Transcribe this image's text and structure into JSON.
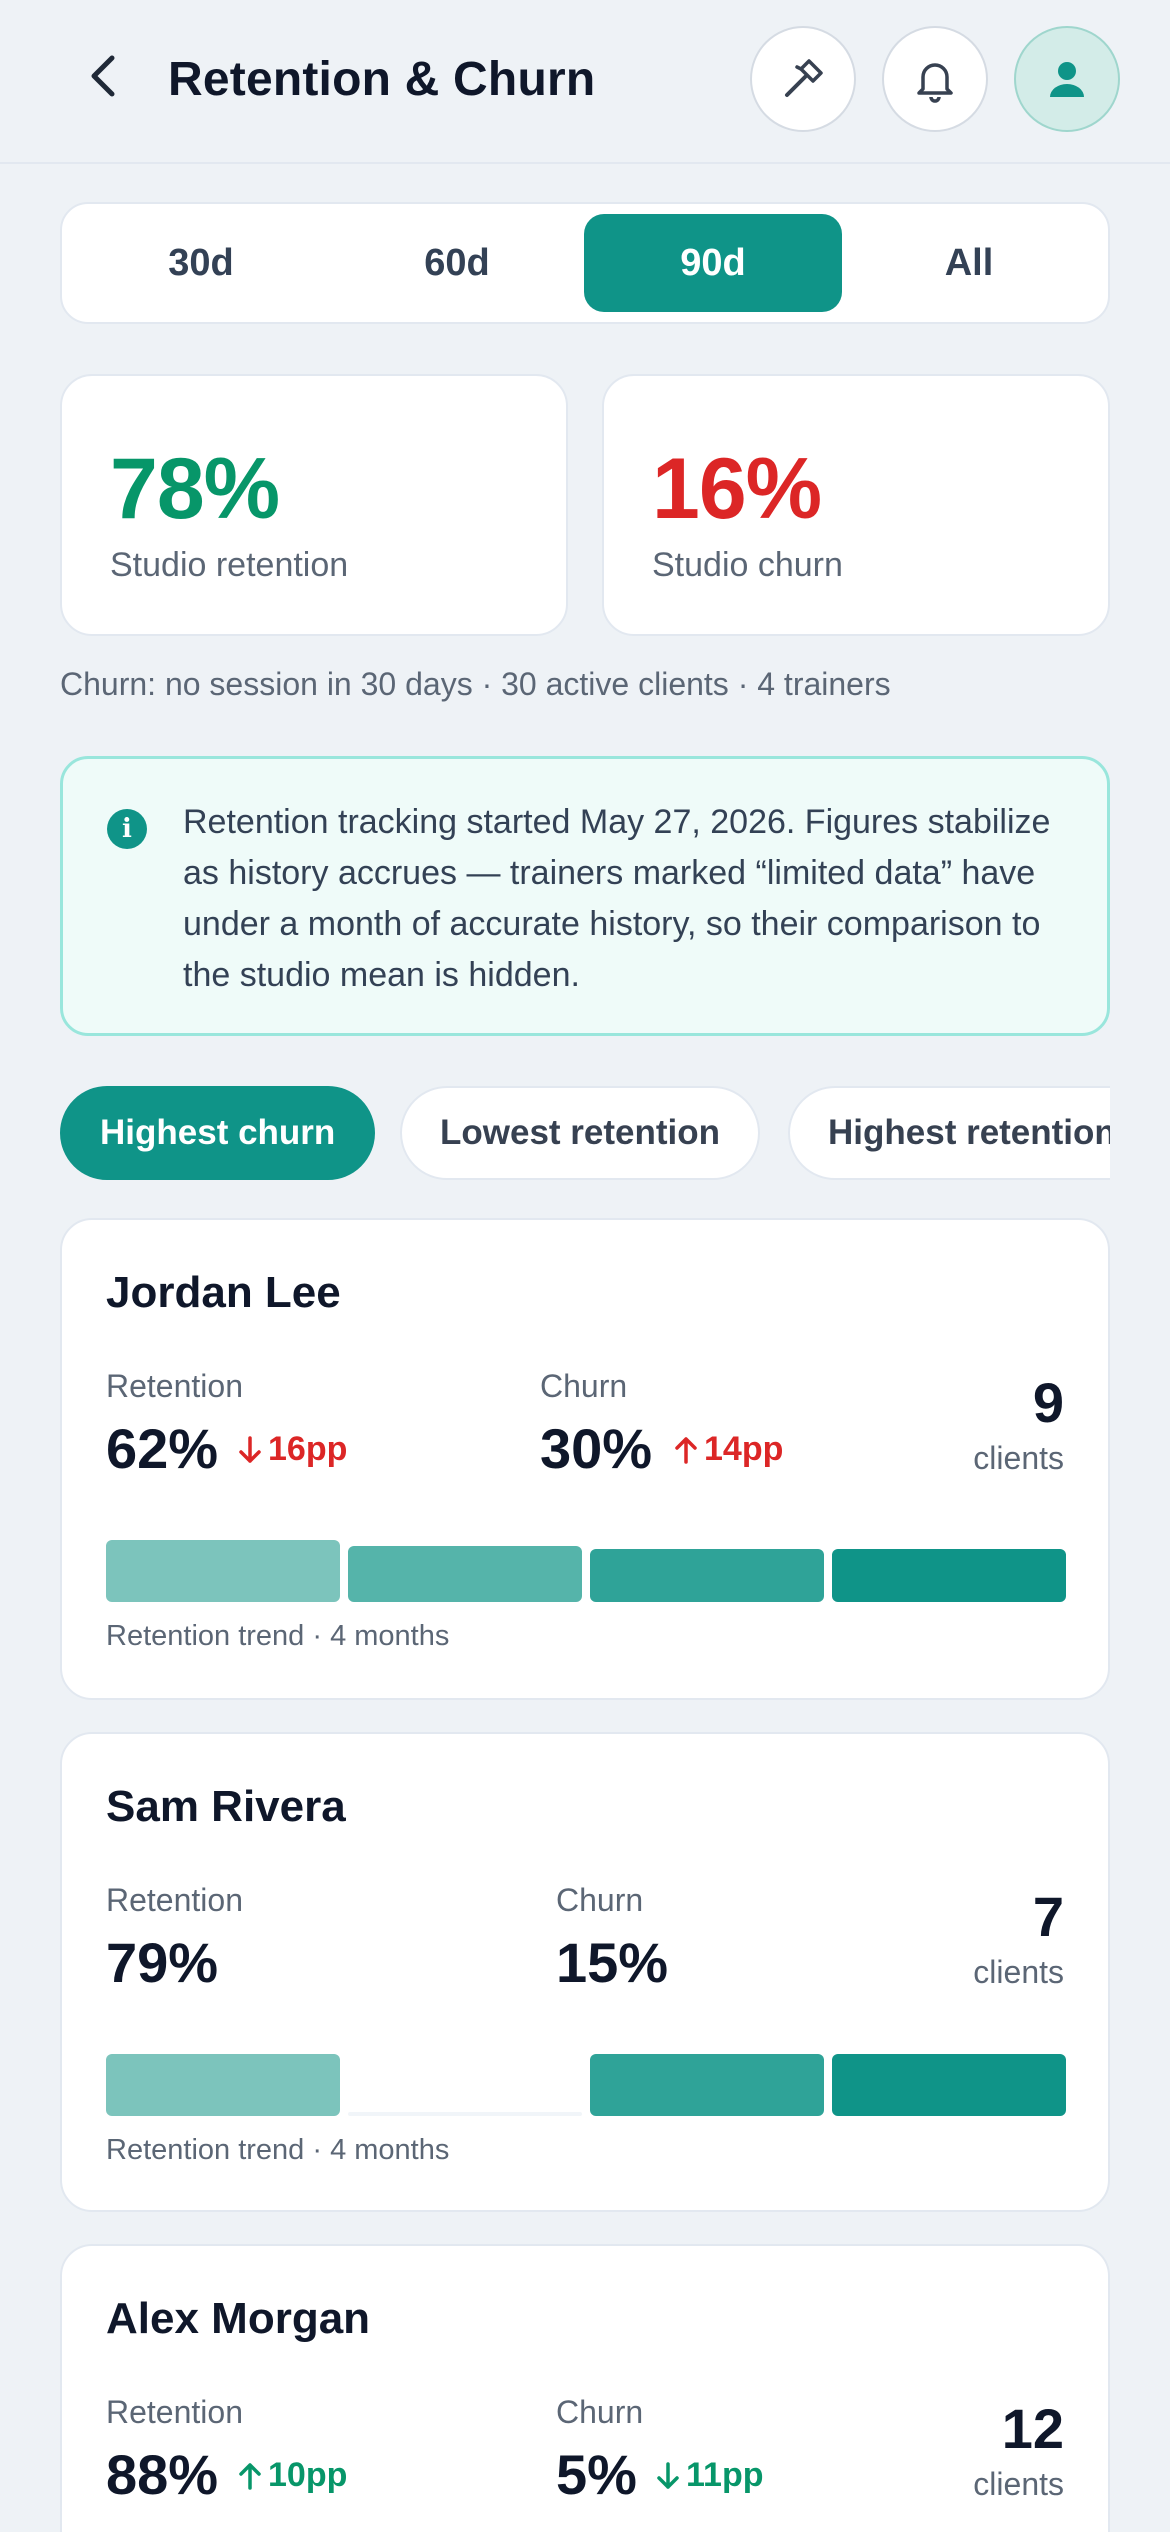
{
  "header": {
    "title": "Retention & Churn",
    "back_icon": "chevron-left-icon",
    "tools_icon": "hammer-icon",
    "notifications_icon": "bell-icon",
    "profile_icon": "user-icon"
  },
  "period": {
    "options": [
      "30d",
      "60d",
      "90d",
      "All"
    ],
    "selected": "90d"
  },
  "stats": {
    "retention": {
      "value": "78%",
      "label": "Studio retention",
      "color": "#079669"
    },
    "churn": {
      "value": "16%",
      "label": "Studio churn",
      "color": "#dc2626"
    }
  },
  "note": "Churn: no session in 30 days · 30 active clients · 4 trainers",
  "info": {
    "icon": "info-icon",
    "text": "Retention tracking started May 27, 2026. Figures stabilize as history accrues — trainers marked “limited data” have under a month of accurate history, so their comparison to the studio mean is hidden."
  },
  "filters": {
    "options": [
      "Highest churn",
      "Lowest retention",
      "Highest retention"
    ],
    "selected": "Highest churn"
  },
  "labels": {
    "retention": "Retention",
    "churn": "Churn",
    "clients": "clients",
    "trend": "Retention trend · 4 months"
  },
  "colors": {
    "accent": "#0f9488",
    "trend": [
      "#7cc4bc",
      "#55b4aa",
      "#2fa398",
      "#0f9488"
    ]
  },
  "trainers": [
    {
      "name": "Jordan Lee",
      "retention": "62%",
      "retention_delta": "16pp",
      "retention_delta_dir": "down",
      "retention_delta_tone": "bad",
      "churn": "30%",
      "churn_delta": "14pp",
      "churn_delta_dir": "up",
      "churn_delta_tone": "bad",
      "clients": "9",
      "trend": [
        1.0,
        0.9,
        0.85,
        0.85
      ]
    },
    {
      "name": "Sam Rivera",
      "retention": "79%",
      "retention_delta": "",
      "churn": "15%",
      "churn_delta": "",
      "clients": "7",
      "trend": [
        1.0,
        0,
        1.0,
        1.0
      ]
    },
    {
      "name": "Alex Morgan",
      "retention": "88%",
      "retention_delta": "10pp",
      "retention_delta_dir": "up",
      "retention_delta_tone": "good",
      "churn": "5%",
      "churn_delta": "11pp",
      "churn_delta_dir": "down",
      "churn_delta_tone": "good",
      "clients": "12",
      "trend": []
    }
  ]
}
